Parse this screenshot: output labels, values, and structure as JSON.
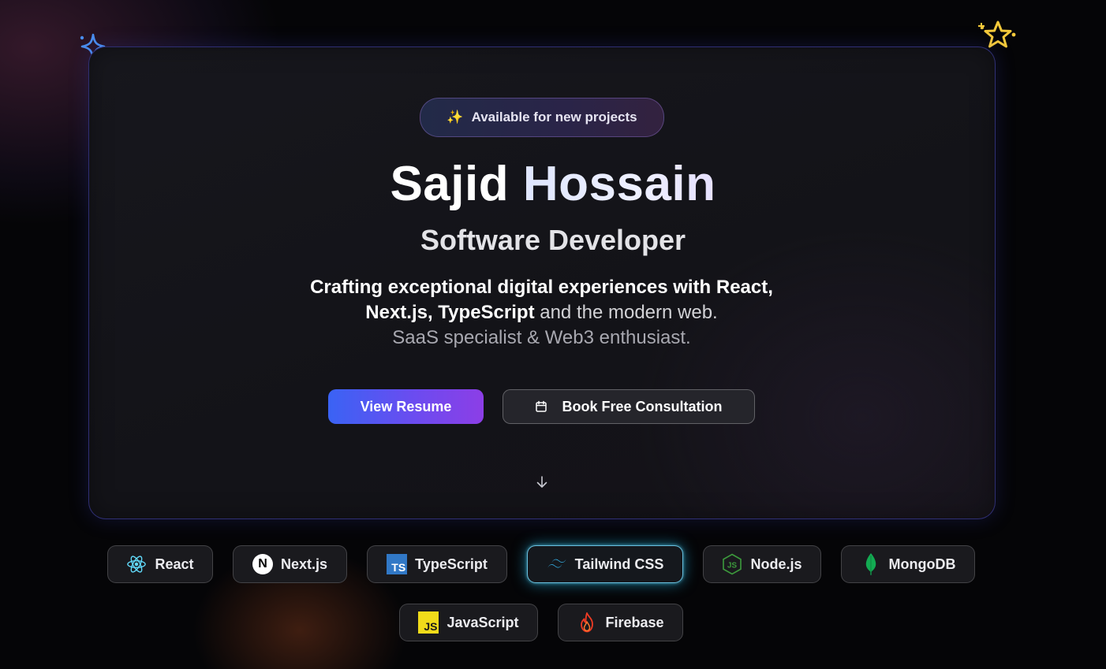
{
  "badge": {
    "emoji": "✨",
    "label": "Available for new projects"
  },
  "hero": {
    "first_name": "Sajid",
    "last_name": "Hossain",
    "role": "Software Developer",
    "tagline": {
      "line1_strong": "Crafting exceptional digital experiences with React,",
      "line2_strong": "Next.js, TypeScript",
      "line2_rest": " and the modern web.",
      "line3": "SaaS specialist & Web3 enthusiast."
    }
  },
  "actions": {
    "resume_label": "View Resume",
    "consult_label": "Book Free Consultation",
    "consult_icon": "calendar-icon"
  },
  "tech_stack": [
    {
      "label": "React",
      "icon": "react-icon"
    },
    {
      "label": "Next.js",
      "icon": "nextjs-icon",
      "glyph": "N"
    },
    {
      "label": "TypeScript",
      "icon": "typescript-icon",
      "glyph": "TS"
    },
    {
      "label": "Tailwind CSS",
      "icon": "tailwind-icon",
      "highlighted": true
    },
    {
      "label": "Node.js",
      "icon": "nodejs-icon",
      "glyph": "JS"
    },
    {
      "label": "MongoDB",
      "icon": "mongodb-icon"
    },
    {
      "label": "JavaScript",
      "icon": "javascript-icon",
      "glyph": "JS"
    },
    {
      "label": "Firebase",
      "icon": "firebase-icon"
    }
  ],
  "colors": {
    "accent_blue": "#3a63f4",
    "accent_purple": "#8c3ee6",
    "glow_cyan": "#28c8ff",
    "sparkle_blue": "#4a8ff0",
    "sparkle_yellow": "#f4c93a"
  }
}
